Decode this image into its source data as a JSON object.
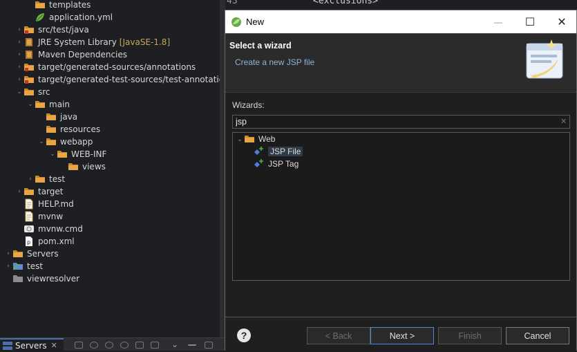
{
  "explorer": {
    "items": [
      {
        "label": "templates",
        "icon": "folder-icon",
        "twisty": ""
      },
      {
        "label": "application.yml",
        "icon": "spring-leaf-icon",
        "twisty": ""
      },
      {
        "label": "src/test/java",
        "icon": "package-folder-icon",
        "twisty": "›"
      },
      {
        "label": "JRE System Library",
        "suffix": "[JavaSE-1.8]",
        "icon": "library-icon",
        "twisty": "›"
      },
      {
        "label": "Maven Dependencies",
        "icon": "library-icon",
        "twisty": "›"
      },
      {
        "label": "target/generated-sources/annotations",
        "icon": "package-folder-icon",
        "twisty": "›"
      },
      {
        "label": "target/generated-test-sources/test-annotations",
        "icon": "package-folder-icon",
        "twisty": "›"
      },
      {
        "label": "src",
        "icon": "folder-icon",
        "twisty": "⌄"
      },
      {
        "label": "main",
        "icon": "folder-icon",
        "twisty": "⌄"
      },
      {
        "label": "java",
        "icon": "folder-icon",
        "twisty": ""
      },
      {
        "label": "resources",
        "icon": "folder-icon",
        "twisty": ""
      },
      {
        "label": "webapp",
        "icon": "folder-icon",
        "twisty": "⌄"
      },
      {
        "label": "WEB-INF",
        "icon": "folder-icon",
        "twisty": "⌄"
      },
      {
        "label": "views",
        "icon": "folder-icon",
        "twisty": ""
      },
      {
        "label": "test",
        "icon": "folder-icon",
        "twisty": "›"
      },
      {
        "label": "target",
        "icon": "folder-icon",
        "twisty": "›"
      },
      {
        "label": "HELP.md",
        "icon": "text-file-icon",
        "twisty": ""
      },
      {
        "label": "mvnw",
        "icon": "text-file-icon",
        "twisty": ""
      },
      {
        "label": "mvnw.cmd",
        "icon": "cmd-file-icon",
        "twisty": ""
      },
      {
        "label": "pom.xml",
        "icon": "pom-file-icon",
        "twisty": ""
      },
      {
        "label": "Servers",
        "icon": "folder-icon",
        "twisty": "›"
      },
      {
        "label": "test",
        "icon": "project-icon",
        "twisty": "›"
      },
      {
        "label": "viewresolver",
        "icon": "closed-project-icon",
        "twisty": ""
      }
    ]
  },
  "editor": {
    "lines": [
      {
        "number": "43",
        "code": "<exclusions>"
      }
    ]
  },
  "bottom": {
    "servers_tab": "Servers",
    "close": "✕"
  },
  "dialog": {
    "title": "New",
    "heading": "Select a wizard",
    "subtitle": "Create a new JSP file",
    "wizards_label": "Wizards:",
    "filter_value": "jsp",
    "tree": [
      {
        "label": "Web",
        "icon": "folder-icon",
        "twisty": "⌄",
        "selected": false
      },
      {
        "label": "JSP File",
        "icon": "jsp-wizard-icon",
        "twisty": "",
        "selected": true
      },
      {
        "label": "JSP Tag",
        "icon": "jsp-wizard-icon",
        "twisty": "",
        "selected": false
      }
    ],
    "buttons": {
      "help": "?",
      "back": "< Back",
      "next": "Next >",
      "finish": "Finish",
      "cancel": "Cancel"
    },
    "window_controls": {
      "minimize": "—",
      "maximize": "☐",
      "close": "✕"
    }
  }
}
